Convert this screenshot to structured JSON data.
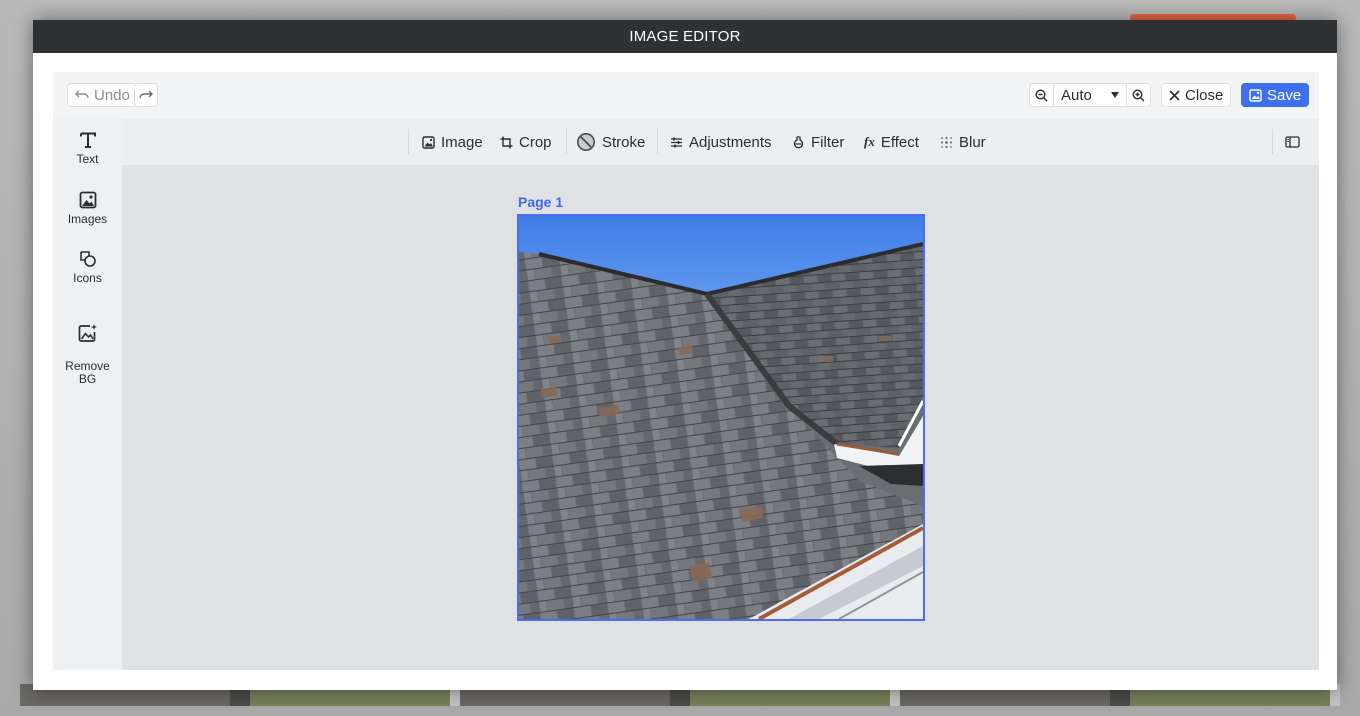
{
  "window": {
    "title": "IMAGE EDITOR"
  },
  "topbar": {
    "undo_label": "Undo",
    "zoom_value": "Auto",
    "close_label": "Close",
    "save_label": "Save"
  },
  "sidebar": {
    "items": [
      {
        "label": "Text",
        "icon": "text-icon"
      },
      {
        "label": "Images",
        "icon": "image-icon"
      },
      {
        "label": "Icons",
        "icon": "shapes-icon"
      },
      {
        "label": "Remove\nBG",
        "icon": "remove-bg-icon"
      }
    ]
  },
  "toolbar": {
    "tools": [
      {
        "label": "Image",
        "icon": "image-icon"
      },
      {
        "label": "Crop",
        "icon": "crop-icon"
      },
      {
        "label": "Stroke",
        "icon": "stroke-icon"
      },
      {
        "label": "Adjustments",
        "icon": "sliders-icon"
      },
      {
        "label": "Filter",
        "icon": "flask-icon"
      },
      {
        "label": "Effect",
        "icon": "fx-icon"
      },
      {
        "label": "Blur",
        "icon": "blur-icon"
      }
    ]
  },
  "canvas": {
    "page_label": "Page 1"
  },
  "colors": {
    "accent": "#3d6fef",
    "titlebar": "#2f3234",
    "page_border": "#4c6cf2"
  }
}
